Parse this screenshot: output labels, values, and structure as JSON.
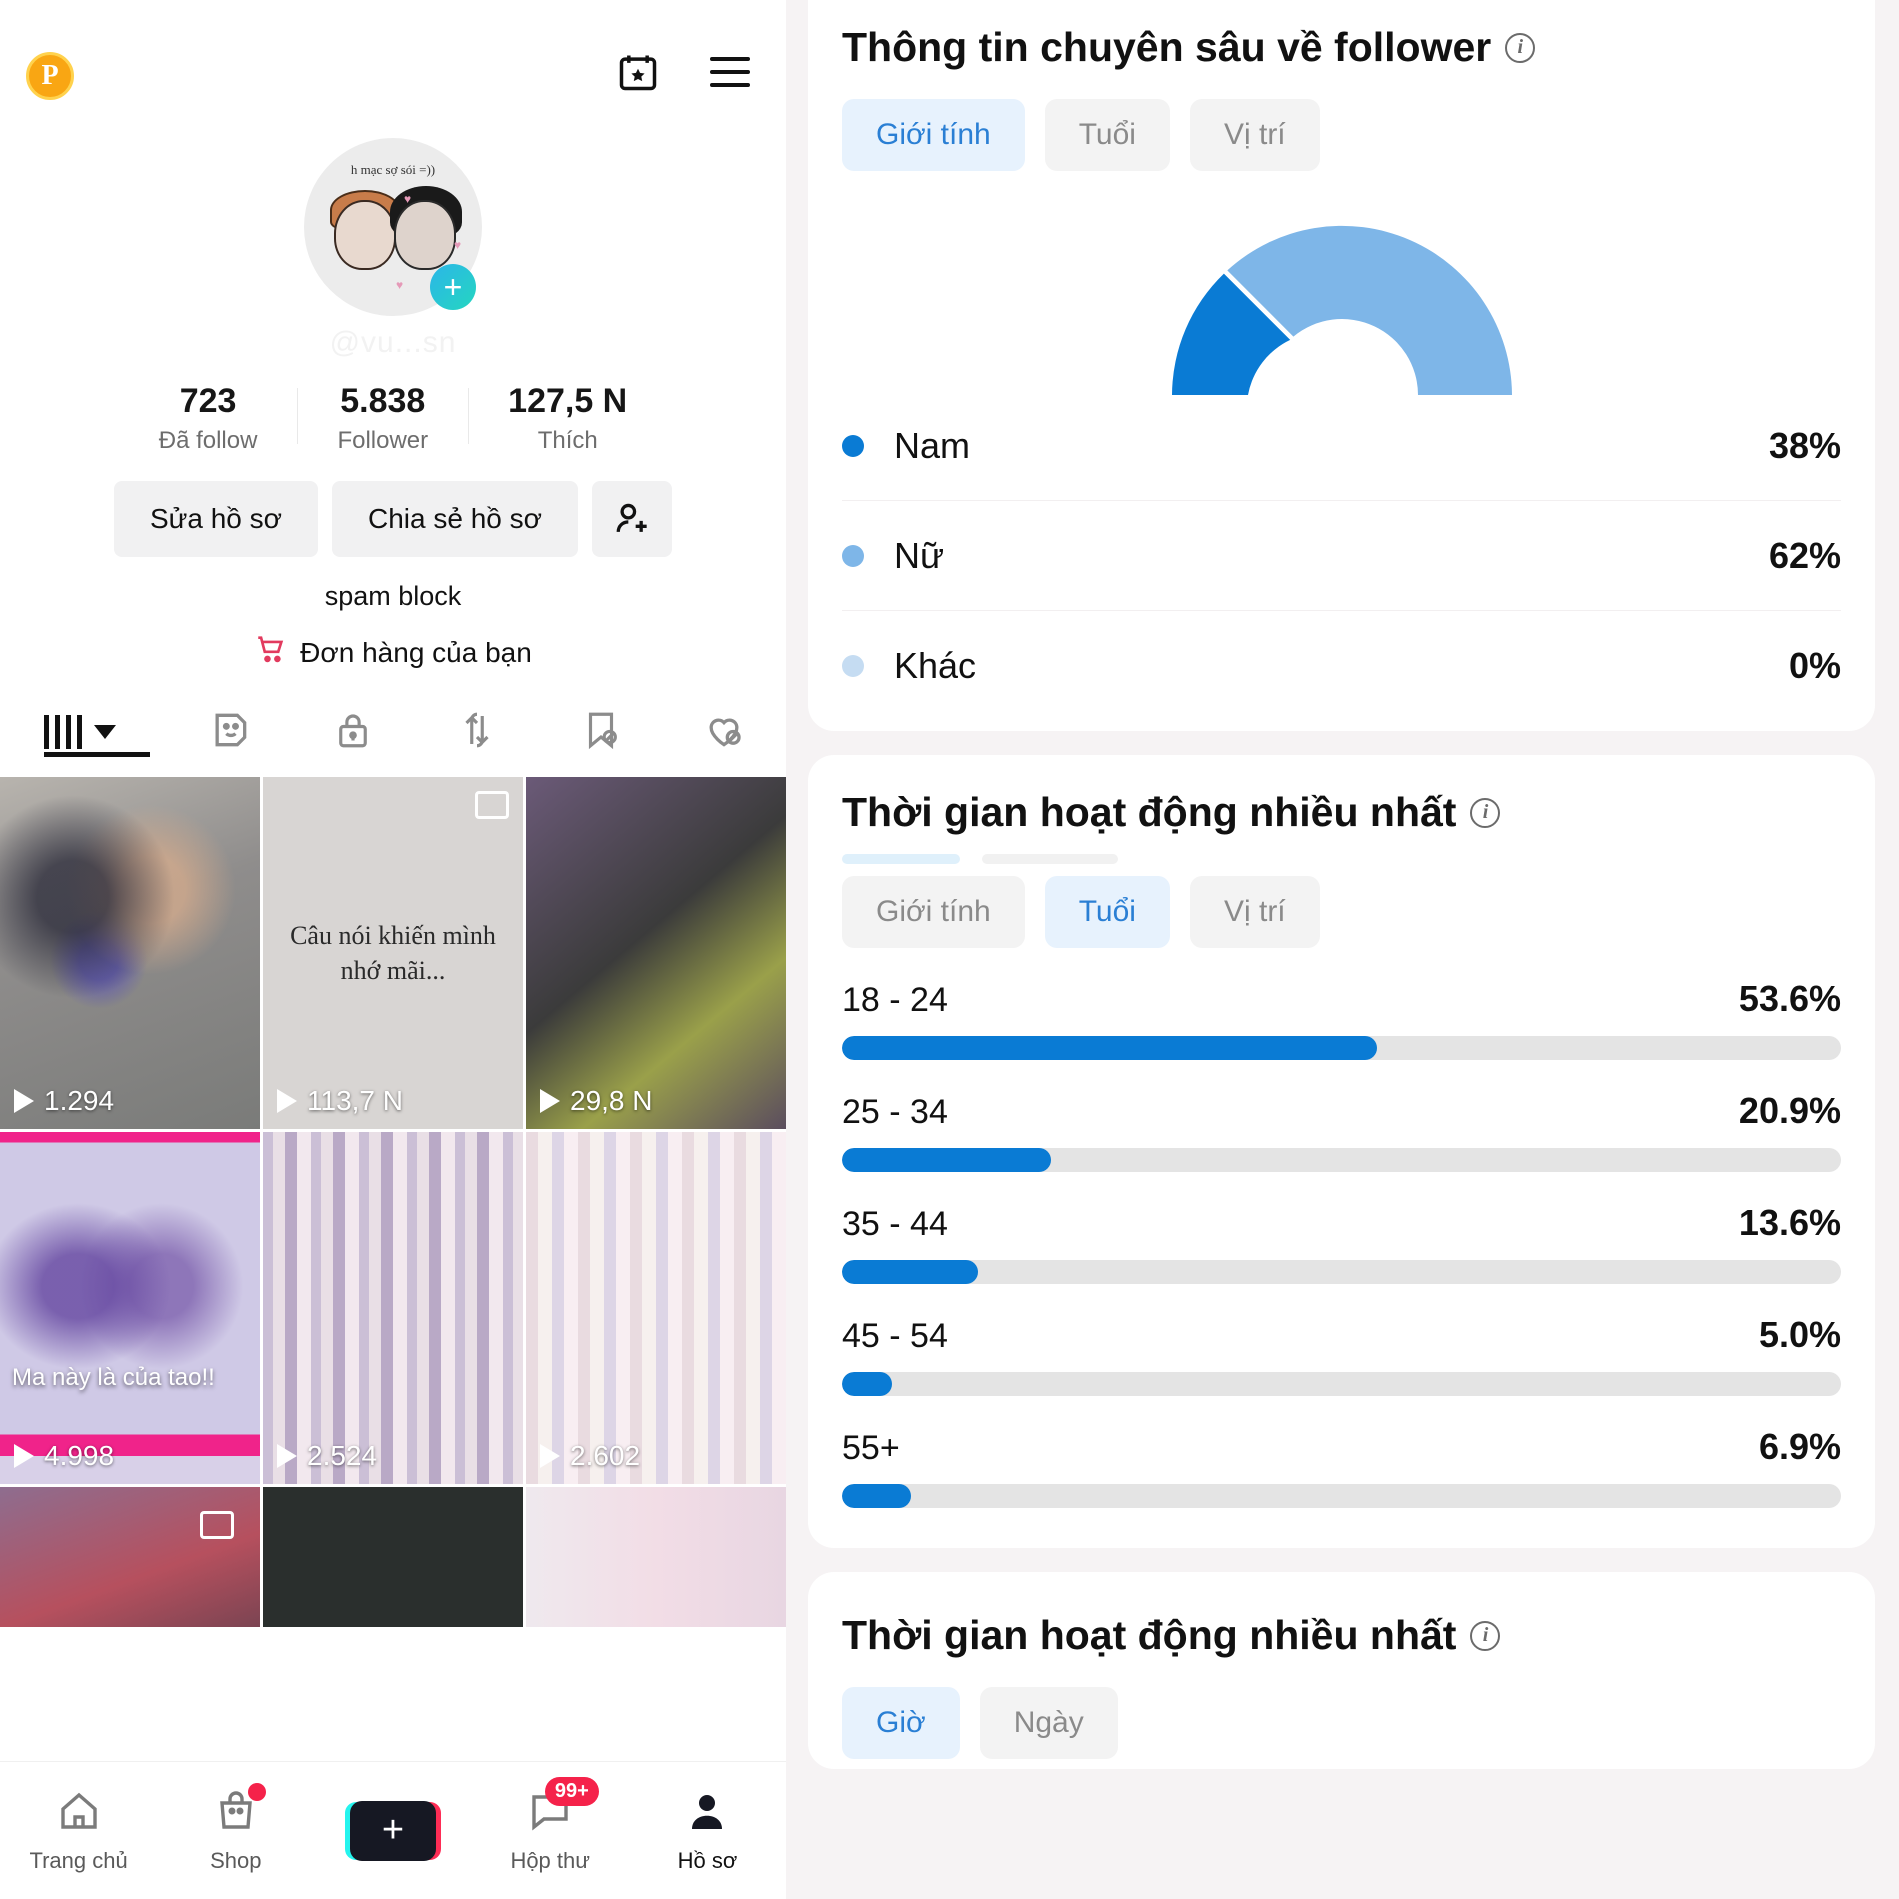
{
  "left": {
    "pro_badge": "P",
    "top_icons": [
      {
        "name": "calendar-star-icon"
      },
      {
        "name": "hamburger-menu-icon"
      }
    ],
    "avatar": {
      "caption": "h mạc sợ sói\n=))",
      "add_badge": "+"
    },
    "handle": "@vu...sn",
    "stats": [
      {
        "value": "723",
        "label": "Đã follow"
      },
      {
        "value": "5.838",
        "label": "Follower"
      },
      {
        "value": "127,5 N",
        "label": "Thích"
      }
    ],
    "actions": {
      "edit_profile": "Sửa hồ sơ",
      "share_profile": "Chia sẻ hồ sơ",
      "add_friend_icon": "add-person-icon"
    },
    "bio": "spam block",
    "orders_label": "Đơn hàng của bạn",
    "orders_icon": "shopping-cart-icon",
    "content_tabs": [
      {
        "name": "grid-videos-tab",
        "icon": "bars-icon"
      },
      {
        "name": "effects-tab",
        "icon": "sticker-smiley-icon"
      },
      {
        "name": "private-tab",
        "icon": "lock-icon"
      },
      {
        "name": "reposts-tab",
        "icon": "repost-arrows-icon"
      },
      {
        "name": "saved-tab",
        "icon": "bookmark-hidden-icon"
      },
      {
        "name": "liked-tab",
        "icon": "heart-hidden-icon"
      }
    ],
    "videos": [
      {
        "views": "1.294",
        "caption": ""
      },
      {
        "views": "113,7 N",
        "caption": "Câu nói khiến\nmình nhớ mãi..."
      },
      {
        "views": "29,8 N",
        "caption": ""
      },
      {
        "views": "4.998",
        "caption": "Ma này là của tao!!"
      },
      {
        "views": "2.524",
        "caption": ""
      },
      {
        "views": "2.602",
        "caption": ""
      }
    ],
    "bottom_nav": [
      {
        "label": "Trang chủ",
        "icon": "home-icon",
        "active": false,
        "badge": ""
      },
      {
        "label": "Shop",
        "icon": "shopping-bag-icon",
        "active": false,
        "badge": "dot"
      },
      {
        "label": "",
        "icon": "create-plus-icon",
        "active": false,
        "badge": ""
      },
      {
        "label": "Hộp thư",
        "icon": "inbox-message-icon",
        "active": false,
        "badge": "99+"
      },
      {
        "label": "Hồ sơ",
        "icon": "profile-person-icon",
        "active": true,
        "badge": ""
      }
    ]
  },
  "right": {
    "follower_card": {
      "title": "Thông tin chuyên sâu về follower",
      "info_icon": "info-icon",
      "tabs": [
        {
          "label": "Giới tính",
          "active": true
        },
        {
          "label": "Tuổi",
          "active": false
        },
        {
          "label": "Vị trí",
          "active": false
        }
      ]
    },
    "activity_card": {
      "title": "Thời gian hoạt động nhiều nhất",
      "info_icon": "info-icon",
      "tabs": [
        {
          "label": "Giới tính",
          "active": false
        },
        {
          "label": "Tuổi",
          "active": true
        },
        {
          "label": "Vị trí",
          "active": false
        }
      ]
    },
    "activity_card_2": {
      "title": "Thời gian hoạt động nhiều nhất",
      "info_icon": "info-icon",
      "tabs": [
        {
          "label": "Giờ",
          "active": true
        },
        {
          "label": "Ngày",
          "active": false
        }
      ]
    }
  },
  "colors": {
    "accent_blue": "#0a7bd4",
    "light_blue": "#7eb6e8",
    "pale_blue": "#c5dcf2",
    "track_gray": "#e4e4e4",
    "tab_active_bg": "#e7f2fd",
    "tab_active_text": "#2a7fd4"
  },
  "chart_data": [
    {
      "type": "pie",
      "title": "Thông tin chuyên sâu về follower",
      "subtitle": "Giới tính",
      "legend_position": "below",
      "labels": [
        "Nam",
        "Nữ",
        "Khác"
      ],
      "values": [
        38,
        62,
        0
      ],
      "value_labels": [
        "38%",
        "62%",
        "0%"
      ],
      "colors": [
        "#0a7bd4",
        "#7eb6e8",
        "#c5dcf2"
      ],
      "shape": "half-donut-gauge"
    },
    {
      "type": "bar",
      "title": "Thời gian hoạt động nhiều nhất",
      "subtitle": "Tuổi",
      "orientation": "horizontal",
      "categories": [
        "18 - 24",
        "25 - 34",
        "35 - 44",
        "45 - 54",
        "55+"
      ],
      "values": [
        53.6,
        20.9,
        13.6,
        5.0,
        6.9
      ],
      "value_labels": [
        "53.6%",
        "20.9%",
        "13.6%",
        "5.0%",
        "6.9%"
      ],
      "xlabel": "",
      "ylabel": "",
      "xlim": [
        0,
        100
      ],
      "grid": false,
      "bar_color": "#0a7bd4",
      "track_color": "#e4e4e4"
    }
  ]
}
